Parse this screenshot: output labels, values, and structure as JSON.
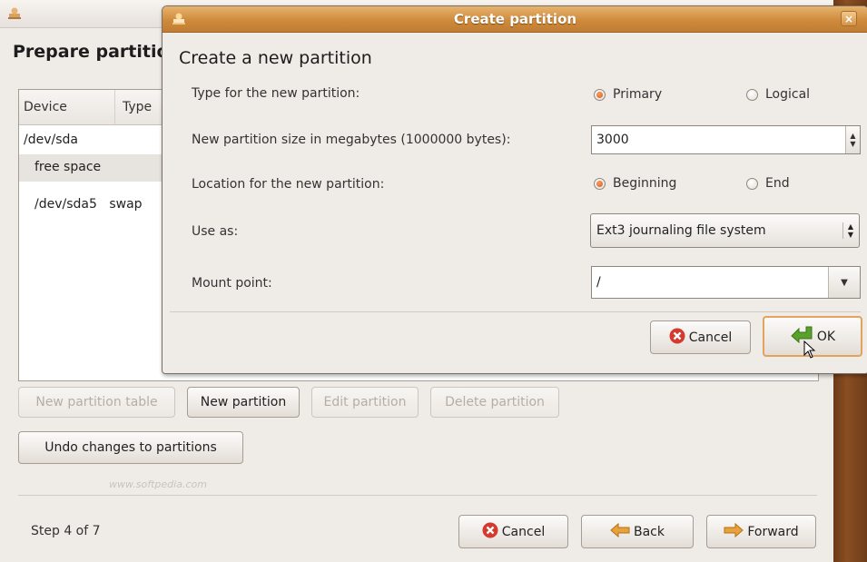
{
  "main_window": {
    "heading": "Prepare partitions",
    "columns": [
      "Device",
      "Type"
    ],
    "rows": [
      {
        "device": "/dev/sda",
        "type": ""
      },
      {
        "device": "free space",
        "type": ""
      },
      {
        "device": "/dev/sda5",
        "type": "swap"
      }
    ],
    "buttons": {
      "new_partition_table": "New partition table",
      "new_partition": "New partition",
      "edit_partition": "Edit partition",
      "delete_partition": "Delete partition",
      "undo_changes": "Undo changes to partitions"
    },
    "step": "Step 4 of 7",
    "watermark": "www.softpedia.com",
    "nav": {
      "cancel": "Cancel",
      "back": "Back",
      "forward": "Forward"
    }
  },
  "dialog": {
    "title": "Create partition",
    "heading": "Create a new partition",
    "close_symbol": "×",
    "fields": {
      "type_label": "Type for the new partition:",
      "type_options": [
        "Primary",
        "Logical"
      ],
      "type_selected": "Primary",
      "size_label": "New partition size in megabytes (1000000 bytes):",
      "size_value": "3000",
      "location_label": "Location for the new partition:",
      "location_options": [
        "Beginning",
        "End"
      ],
      "location_selected": "Beginning",
      "use_as_label": "Use as:",
      "use_as_value": "Ext3 journaling file system",
      "mount_label": "Mount point:",
      "mount_value": "/"
    },
    "buttons": {
      "cancel": "Cancel",
      "ok": "OK"
    }
  },
  "colors": {
    "dialog_titlebar": "#cf8a3b",
    "radio_selected": "#d9571b",
    "cancel_icon": "#d23b2e",
    "arrow_icon": "#e9a23b",
    "ok_arrow_icon": "#5aa02c"
  },
  "icons": {
    "cancel": "cancel-circle-icon",
    "back": "back-arrow-icon",
    "forward": "forward-arrow-icon",
    "ok": "ok-arrow-icon",
    "app": "installer-icon"
  }
}
